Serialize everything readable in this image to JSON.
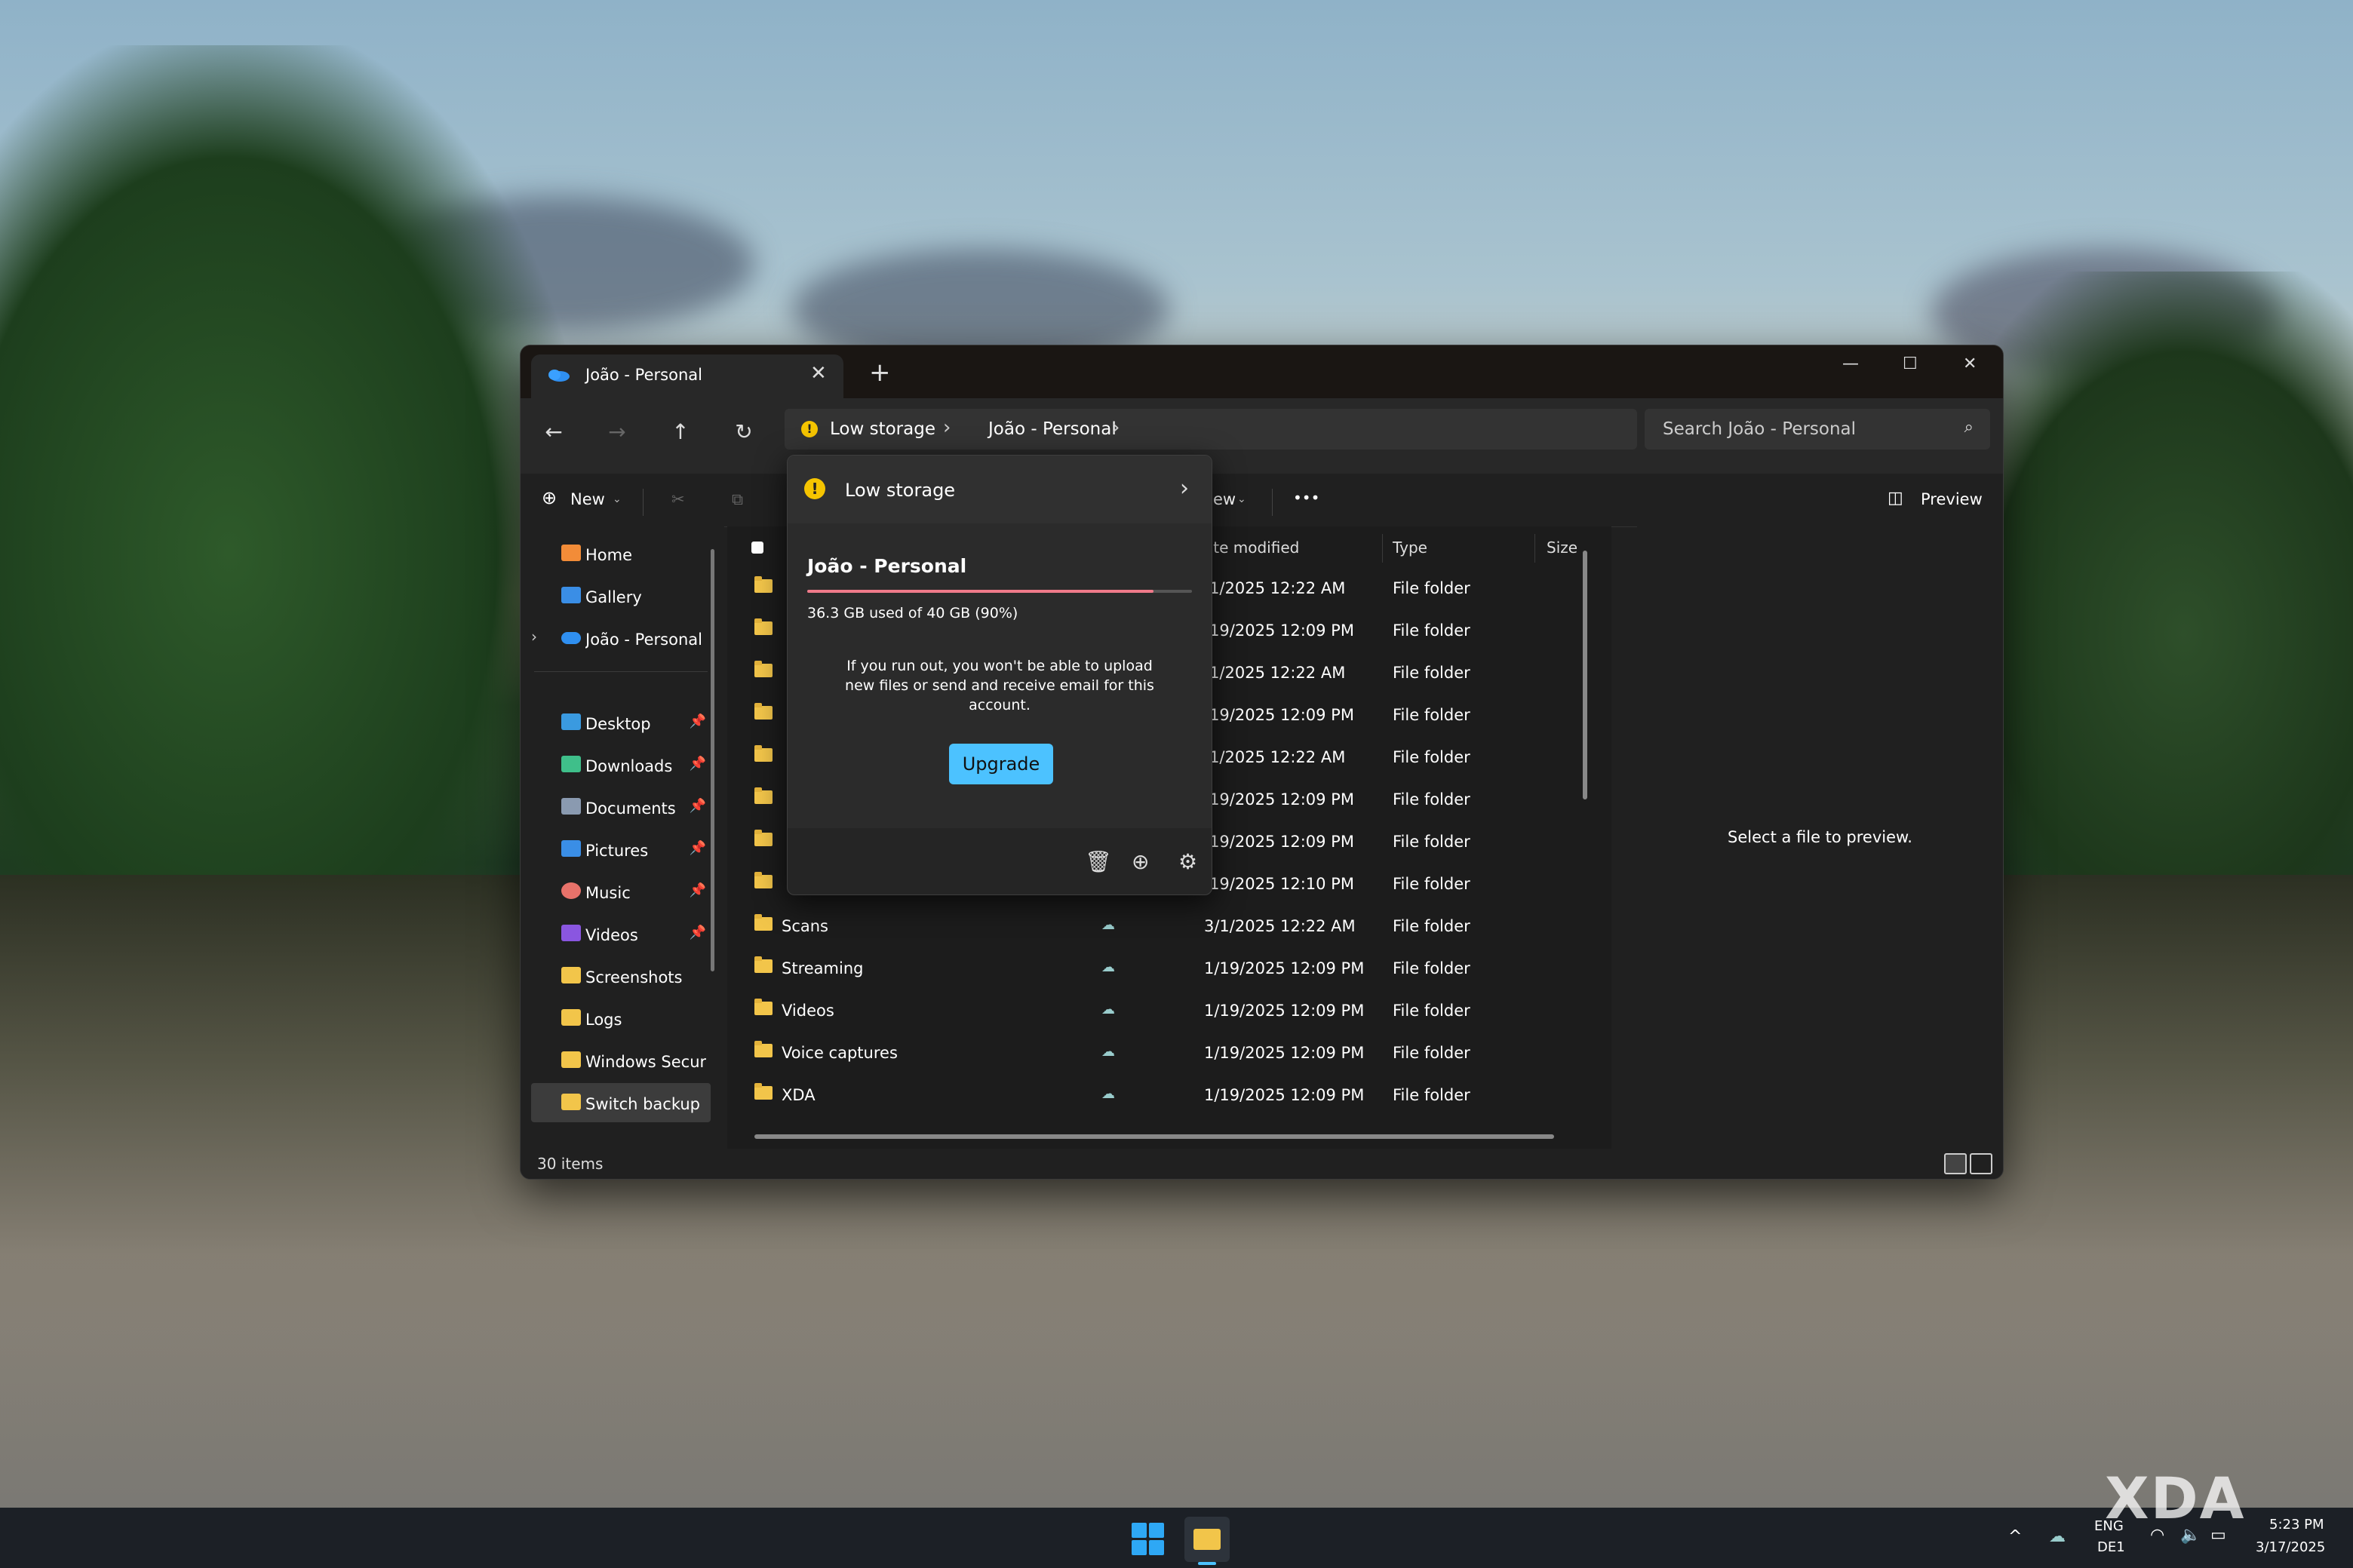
{
  "window": {
    "tab_title": "João - Personal",
    "tab_close": "✕",
    "new_tab": "+",
    "minimize": "—",
    "maximize": "☐",
    "close": "✕"
  },
  "nav": {
    "back": "←",
    "forward": "→",
    "up": "↑",
    "refresh": "↻"
  },
  "address": {
    "warning_label": "Low storage",
    "location": "João - Personal"
  },
  "search": {
    "placeholder": "Search João - Personal"
  },
  "commandbar": {
    "new_label": "New",
    "view_label": "ew",
    "more_label": "•••",
    "preview_label": "Preview"
  },
  "sidebar": {
    "items": [
      {
        "label": "Home",
        "icon": "home-icon",
        "color": "#f28c38"
      },
      {
        "label": "Gallery",
        "icon": "gallery-icon",
        "color": "#3a8ee6"
      },
      {
        "label": "João - Personal",
        "icon": "onedrive-icon",
        "color": "#2f8ff0"
      },
      {
        "label": "Desktop",
        "icon": "desktop-icon",
        "color": "#3a9ae0",
        "pinned": true
      },
      {
        "label": "Downloads",
        "icon": "download-icon",
        "color": "#3fbf8a",
        "pinned": true
      },
      {
        "label": "Documents",
        "icon": "documents-icon",
        "color": "#8a9ab0",
        "pinned": true
      },
      {
        "label": "Pictures",
        "icon": "pictures-icon",
        "color": "#3a8ee6",
        "pinned": true
      },
      {
        "label": "Music",
        "icon": "music-icon",
        "color": "#e8726a",
        "pinned": true
      },
      {
        "label": "Videos",
        "icon": "videos-icon",
        "color": "#8a56e0",
        "pinned": true
      },
      {
        "label": "Screenshots",
        "icon": "folder-icon",
        "color": "#f2c54a"
      },
      {
        "label": "Logs",
        "icon": "folder-icon",
        "color": "#f2c54a"
      },
      {
        "label": "Windows Securit",
        "icon": "folder-icon",
        "color": "#f2c54a"
      },
      {
        "label": "Switch backup",
        "icon": "folder-icon",
        "color": "#f2c54a",
        "selected": true
      }
    ]
  },
  "filelist": {
    "headers": {
      "date": "ate modified",
      "type": "Type",
      "size": "Size"
    },
    "rows": [
      {
        "name": "",
        "date": "/1/2025 12:22 AM",
        "type": "File folder"
      },
      {
        "name": "",
        "date": "/19/2025 12:09 PM",
        "type": "File folder"
      },
      {
        "name": "",
        "date": "/1/2025 12:22 AM",
        "type": "File folder"
      },
      {
        "name": "",
        "date": "/19/2025 12:09 PM",
        "type": "File folder"
      },
      {
        "name": "",
        "date": "/1/2025 12:22 AM",
        "type": "File folder"
      },
      {
        "name": "",
        "date": "/19/2025 12:09 PM",
        "type": "File folder"
      },
      {
        "name": "",
        "date": "/19/2025 12:09 PM",
        "type": "File folder"
      },
      {
        "name": "",
        "date": "/19/2025 12:10 PM",
        "type": "File folder"
      },
      {
        "name": "Scans",
        "date": "3/1/2025 12:22 AM",
        "type": "File folder"
      },
      {
        "name": "Streaming",
        "date": "1/19/2025 12:09 PM",
        "type": "File folder"
      },
      {
        "name": "Videos",
        "date": "1/19/2025 12:09 PM",
        "type": "File folder"
      },
      {
        "name": "Voice captures",
        "date": "1/19/2025 12:09 PM",
        "type": "File folder"
      },
      {
        "name": "XDA",
        "date": "1/19/2025 12:09 PM",
        "type": "File folder"
      }
    ]
  },
  "preview": {
    "message": "Select a file to preview."
  },
  "status": {
    "items": "30 items"
  },
  "popup": {
    "header_label": "Low storage",
    "account": "João - Personal",
    "usage": "36.3 GB used of 40 GB (90%)",
    "usage_fraction": 0.9,
    "message": "If you run out, you won't be able to upload new files or send and receive email for this account.",
    "upgrade_label": "Upgrade"
  },
  "taskbar": {
    "language_top": "ENG",
    "language_bottom": "DE1",
    "time": "5:23 PM",
    "date": "3/17/2025",
    "chevron": "^"
  },
  "watermark": "XDA"
}
